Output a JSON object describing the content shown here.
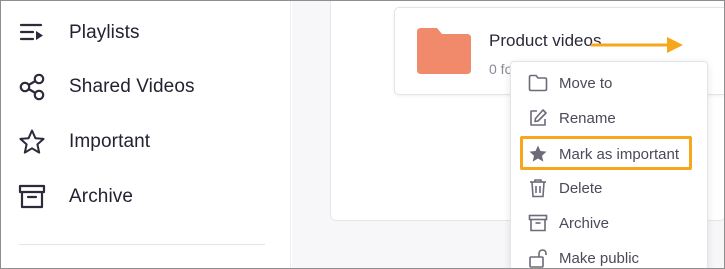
{
  "sidebar": {
    "items": [
      {
        "label": "Playlists",
        "icon": "playlist-icon"
      },
      {
        "label": "Shared Videos",
        "icon": "share-icon"
      },
      {
        "label": "Important",
        "icon": "star-icon"
      },
      {
        "label": "Archive",
        "icon": "archive-icon"
      }
    ]
  },
  "folder": {
    "title": "Product videos",
    "meta": "0 folder",
    "color": "#f08a6a"
  },
  "menu": {
    "items": [
      {
        "label": "Move to",
        "icon": "folder-icon"
      },
      {
        "label": "Rename",
        "icon": "edit-icon"
      },
      {
        "label": "Mark as important",
        "icon": "star-filled-icon"
      },
      {
        "label": "Delete",
        "icon": "trash-icon"
      },
      {
        "label": "Archive",
        "icon": "archive-icon"
      },
      {
        "label": "Make public",
        "icon": "unlock-icon"
      }
    ]
  },
  "colors": {
    "accent": "#f5a81c",
    "text": "#222232",
    "muted": "#8a8a98"
  }
}
